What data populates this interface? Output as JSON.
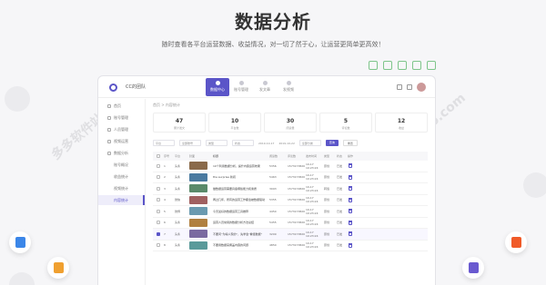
{
  "page": {
    "title": "数据分析",
    "subtitle": "随时查看各平台运营数据、收益情况，对一切了然于心，让运营更简单更高效！"
  },
  "toolbar_icons": [
    "refresh-icon",
    "expand-icon",
    "edit-icon",
    "export-icon",
    "settings-icon"
  ],
  "window": {
    "org_name": "CC的团队",
    "nav": [
      {
        "label": "数据中心",
        "active": true
      },
      {
        "label": "账号管理",
        "active": false
      },
      {
        "label": "发文章",
        "active": false
      },
      {
        "label": "发视频",
        "active": false
      }
    ],
    "sidebar": [
      {
        "label": "首页",
        "icon": "home-icon",
        "sub": false,
        "active": false
      },
      {
        "label": "账号管理",
        "icon": "account-icon",
        "sub": false,
        "active": false
      },
      {
        "label": "人员管理",
        "icon": "person-icon",
        "sub": false,
        "active": false
      },
      {
        "label": "视频运营",
        "icon": "video-icon",
        "sub": false,
        "active": false
      },
      {
        "label": "数据分析",
        "icon": "chart-icon",
        "sub": false,
        "active": false
      },
      {
        "label": "账号概况",
        "icon": "",
        "sub": true,
        "active": false
      },
      {
        "label": "收益统计",
        "icon": "",
        "sub": true,
        "active": false
      },
      {
        "label": "视频统计",
        "icon": "",
        "sub": true,
        "active": false
      },
      {
        "label": "内容统计",
        "icon": "",
        "sub": true,
        "active": true
      }
    ],
    "breadcrumb": "首页 > 内容统计",
    "stats": [
      {
        "value": "47",
        "label": "累计发文"
      },
      {
        "value": "10",
        "label": "平台数"
      },
      {
        "value": "30",
        "label": "阅读量"
      },
      {
        "value": "5",
        "label": "评论数"
      },
      {
        "value": "12",
        "label": "收益"
      }
    ],
    "filters": {
      "platform": "平台",
      "account": "全部账号",
      "type": "类型",
      "status": "状态",
      "date_start": "2019-10-17",
      "date_end": "2019-10-22",
      "category": "全部分类",
      "search_btn": "查询",
      "reset_btn": "重置"
    },
    "table": {
      "headers": [
        "序号",
        "平台",
        "封面",
        "标题",
        "阅读数",
        "评论数",
        "发布时间",
        "类型",
        "状态",
        "操作"
      ],
      "rows": [
        {
          "no": "1",
          "plat": "头条",
          "title": "10个利用数据分析，提升内容运营效果",
          "read": "5356",
          "comment": "1573173820",
          "time": "10-17 10:23:24",
          "type": "原创",
          "status": "已发",
          "checked": false,
          "thumb": "#8a6a4a"
        },
        {
          "no": "2",
          "plat": "头条",
          "title": "the surprise 新闻",
          "read": "5463",
          "comment": "1573173820",
          "time": "10-17 10:23:24",
          "type": "原创",
          "status": "已发",
          "checked": false,
          "thumb": "#4a7aa0"
        },
        {
          "no": "3",
          "plat": "头条",
          "title": "做数据运营需要具备哪些能力和素质",
          "read": "3093",
          "comment": "1573174820",
          "time": "10-17 10:23:24",
          "type": "转载",
          "status": "已发",
          "checked": false,
          "thumb": "#5a8a6a"
        },
        {
          "no": "4",
          "plat": "微信",
          "title": "再过几年，所有的运营工作都会被数据驱动",
          "read": "5355",
          "comment": "1573173820",
          "time": "10-17 10:23:24",
          "type": "原创",
          "status": "已发",
          "checked": false,
          "thumb": "#a06060"
        },
        {
          "no": "5",
          "plat": "微博",
          "title": "今天最好的数据运营工具推荐",
          "read": "4450",
          "comment": "1573173820",
          "time": "10-17 10:23:24",
          "type": "原创",
          "status": "已发",
          "checked": false,
          "thumb": "#6a9ab0"
        },
        {
          "no": "6",
          "plat": "头条",
          "title": "运营人员常用的数据分析方法总结",
          "read": "5455",
          "comment": "1573173820",
          "time": "10-17 10:23:24",
          "type": "原创",
          "status": "已发",
          "checked": false,
          "thumb": "#b08040"
        },
        {
          "no": "7",
          "plat": "头条",
          "title": "不要问“为啥人家的”，先学会“看懂数据”",
          "read": "3209",
          "comment": "1573173820",
          "time": "10-17 10:23:24",
          "type": "原创",
          "status": "已发",
          "checked": true,
          "thumb": "#7a6aa0"
        },
        {
          "no": "8",
          "plat": "头条",
          "title": "不要用数据来掩盖内容的问题",
          "read": "4850",
          "comment": "1573173820",
          "time": "10-17 10:23:24",
          "type": "原创",
          "status": "已发",
          "checked": false,
          "thumb": "#5a9a9a"
        }
      ]
    }
  },
  "floating_icons": [
    {
      "name": "document-icon",
      "color": "#3b86e8"
    },
    {
      "name": "image-icon",
      "color": "#f0a030"
    },
    {
      "name": "fire-icon",
      "color": "#f05a28"
    },
    {
      "name": "bar-chart-icon",
      "color": "#6a5ad0"
    }
  ],
  "watermarks": [
    "多多软件站",
    "www.ddooo.com"
  ]
}
